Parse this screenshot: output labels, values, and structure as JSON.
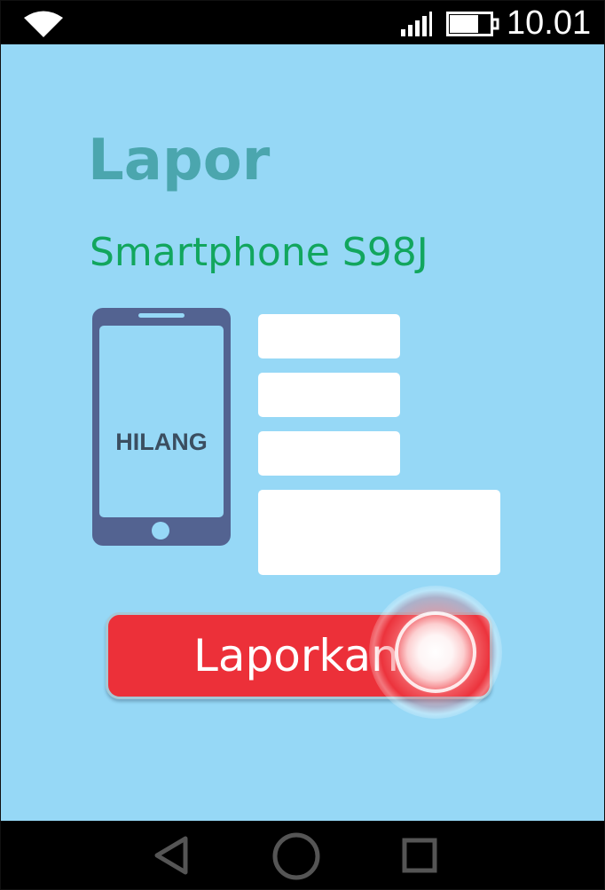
{
  "status_bar": {
    "time": "10.01",
    "icons": [
      "wifi-icon",
      "signal-icon",
      "battery-icon"
    ]
  },
  "page": {
    "title": "Lapor",
    "subtitle": "Smartphone S98J"
  },
  "illustration": {
    "label": "HILANG",
    "icon": "smartphone-icon"
  },
  "form": {
    "fields": [
      {
        "value": "",
        "placeholder": ""
      },
      {
        "value": "",
        "placeholder": ""
      },
      {
        "value": "",
        "placeholder": ""
      },
      {
        "value": "",
        "placeholder": ""
      }
    ]
  },
  "actions": {
    "report_label": "Laporkan"
  },
  "nav_bar": {
    "icons": [
      "back-icon",
      "home-icon",
      "recent-apps-icon"
    ]
  },
  "colors": {
    "background": "#96d8f6",
    "title": "#4ba6ae",
    "subtitle": "#12a65e",
    "phone": "#536391",
    "button": "#ec3039",
    "bars": "#000000"
  }
}
